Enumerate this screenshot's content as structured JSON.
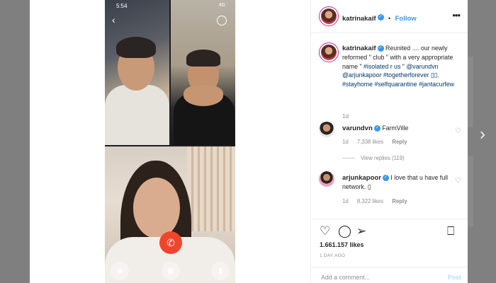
{
  "phone": {
    "time": "5:54",
    "status": "4G"
  },
  "header": {
    "username": "katrinakaif",
    "separator": "•",
    "follow_label": "Follow",
    "more_label": "•••"
  },
  "caption": {
    "username": "katrinakaif",
    "text": "Reunited .... our newly reformed \" club \" with a very appropriate name \" ",
    "tag1": "#isolated r us",
    "text2": " \" ",
    "mentions": "@varundvn @arjunkapoor",
    "tags": "#togetherforever ▯▯. #stayhome #selfquarantine #jantacurfew",
    "time": "1d"
  },
  "comments": [
    {
      "username": "varundvn",
      "text": "FarmVille",
      "time": "1d",
      "likes": "7,338 likes",
      "reply": "Reply"
    },
    {
      "username": "arjunkapoor",
      "text": "I love that u have full network. ▯",
      "time": "1d",
      "likes": "8,322 likes",
      "reply": "Reply"
    }
  ],
  "view_replies": "View replies (119)",
  "actions": {
    "likes": "1.661.157 likes",
    "date": "1 DAY AGO"
  },
  "add_comment": {
    "placeholder": "Add a comment...",
    "post_label": "Post"
  },
  "icons": {
    "heart": "heart-icon",
    "comment": "comment-icon",
    "share": "share-icon",
    "save": "bookmark-icon",
    "end_call": "phone-hangup-icon"
  },
  "colors": {
    "link": "#3897f0",
    "end_call": "#f0452c",
    "verified": "#3897f0"
  }
}
